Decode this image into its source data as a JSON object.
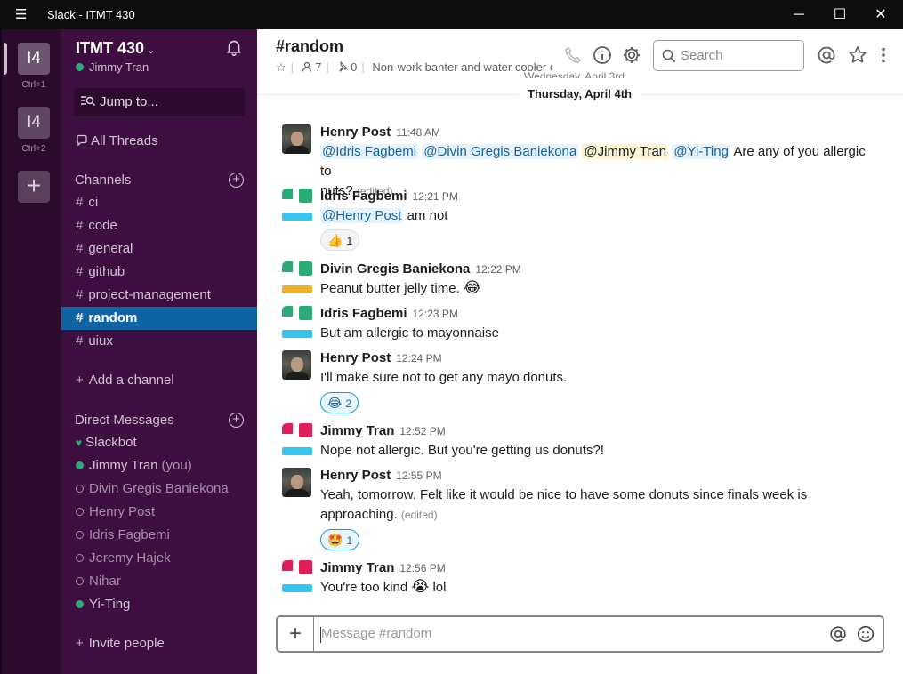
{
  "window": {
    "title": "Slack - ITMT 430"
  },
  "rail": {
    "workspaces": [
      {
        "label": "I4",
        "shortcut": "Ctrl+1"
      },
      {
        "label": "I4",
        "shortcut": "Ctrl+2"
      }
    ],
    "add_label": "+"
  },
  "sidebar": {
    "team_name": "ITMT 430",
    "user_name": "Jimmy Tran",
    "jump_label": "Jump to...",
    "threads_label": "All Threads",
    "channels_header": "Channels",
    "channels": [
      "ci",
      "code",
      "general",
      "github",
      "project-management",
      "random",
      "uiux"
    ],
    "active_channel": "random",
    "add_channel_label": "Add a channel",
    "dm_header": "Direct Messages",
    "dms": [
      {
        "name": "Slackbot",
        "status": "heart"
      },
      {
        "name": "Jimmy Tran",
        "status": "online",
        "suffix": "(you)"
      },
      {
        "name": "Divin Gregis Baniekona",
        "status": "offline"
      },
      {
        "name": "Henry Post",
        "status": "offline"
      },
      {
        "name": "Idris Fagbemi",
        "status": "offline"
      },
      {
        "name": "Jeremy Hajek",
        "status": "offline"
      },
      {
        "name": "Nihar",
        "status": "offline"
      },
      {
        "name": "Yi-Ting",
        "status": "online"
      }
    ],
    "invite_label": "Invite people"
  },
  "header": {
    "channel": "#random",
    "members": "7",
    "pins": "0",
    "topic": "Non-work banter and water cooler c",
    "search_placeholder": "Search"
  },
  "divider": {
    "ghost": "Wednesday, April 3rd",
    "date": "Thursday, April 4th"
  },
  "messages": [
    {
      "sender": "Henry Post",
      "time": "11:48 AM",
      "avatar": "photo",
      "mentions": [
        "@Idris Fagbemi",
        "@Divin Gregis Baniekona",
        "@Jimmy Tran",
        "@Yi-Ting"
      ],
      "text": "Are any of you allergic to",
      "text2": "nuts?",
      "edited": "(edited)"
    },
    {
      "sender": "Idris Fagbemi",
      "time": "12:21 PM",
      "avatar": "identicon-green",
      "mention": "@Henry Post",
      "text": "am not",
      "reaction": {
        "emoji": "👍",
        "count": "1"
      }
    },
    {
      "sender": "Divin Gregis Baniekona",
      "time": "12:22 PM",
      "avatar": "identicon-yellow",
      "text": "Peanut butter jelly time.",
      "emoji": "😂"
    },
    {
      "sender": "Idris Fagbemi",
      "time": "12:23 PM",
      "avatar": "identicon-green",
      "text": "But am allergic to mayonnaise"
    },
    {
      "sender": "Henry Post",
      "time": "12:24 PM",
      "avatar": "photo",
      "text": "I'll make sure not to get any mayo donuts.",
      "reaction": {
        "emoji": "😂",
        "count": "2"
      }
    },
    {
      "sender": "Jimmy Tran",
      "time": "12:52 PM",
      "avatar": "identicon-red",
      "text": "Nope not allergic. But you're getting us donuts?!"
    },
    {
      "sender": "Henry Post",
      "time": "12:55 PM",
      "avatar": "photo",
      "text": "Yeah, tomorrow. Felt like it would be nice to have some donuts since finals week is",
      "text2": "approaching.",
      "edited": "(edited)",
      "reaction": {
        "emoji": "🤩",
        "count": "1"
      }
    },
    {
      "sender": "Jimmy Tran",
      "time": "12:56 PM",
      "avatar": "identicon-red",
      "text": "You're too kind",
      "emoji": "😭",
      "text_after": "lol"
    }
  ],
  "composer": {
    "placeholder": "Message #random",
    "plus": "+"
  },
  "colors": {
    "sidebar": "#3f0e40",
    "active": "#1164a3",
    "online": "#2bac76",
    "green": "#2bac76",
    "yellow": "#ecb22e",
    "red": "#e01e5a",
    "blue": "#36c5f0"
  }
}
